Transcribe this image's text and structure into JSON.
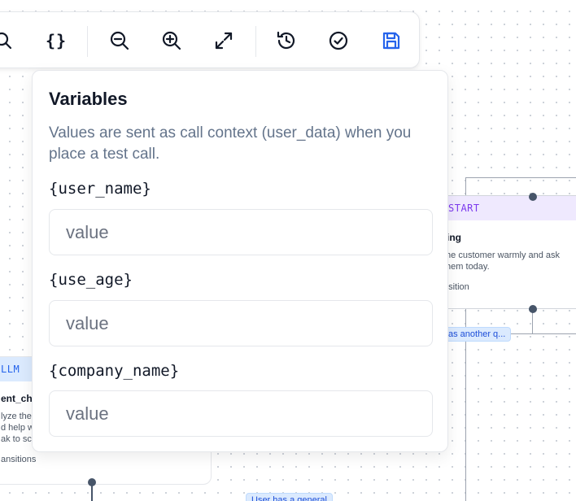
{
  "toolbar": {
    "icons": [
      "search-icon",
      "variables-icon",
      "zoom-out-icon",
      "zoom-in-icon",
      "fit-view-icon",
      "history-icon",
      "validate-icon",
      "save-icon"
    ],
    "variables_glyph": "{}",
    "accent_color": "#2563eb"
  },
  "variables_panel": {
    "title": "Variables",
    "description": "Values are sent as call context (user_data) when you place a test call.",
    "variables": [
      {
        "label": "{user_name}",
        "placeholder": "value"
      },
      {
        "label": "{use_age}",
        "placeholder": "value"
      },
      {
        "label": "{company_name}",
        "placeholder": "value"
      }
    ]
  },
  "canvas": {
    "start_node": {
      "badge": "START",
      "title_visible": "ting",
      "description_visible": "the customer warmly and ask them today.",
      "transitions_visible": "nsition",
      "badge_color": "#7c3aed"
    },
    "llm_node": {
      "badge": "LLM",
      "title_visible": "ent_ch",
      "description_lines": [
        "lyze the",
        "d help w",
        "ak to sc"
      ],
      "transitions_visible": "ansitions",
      "badge_color": "#2563eb"
    },
    "edge_labels": [
      "as another q...",
      "User has a general"
    ]
  }
}
